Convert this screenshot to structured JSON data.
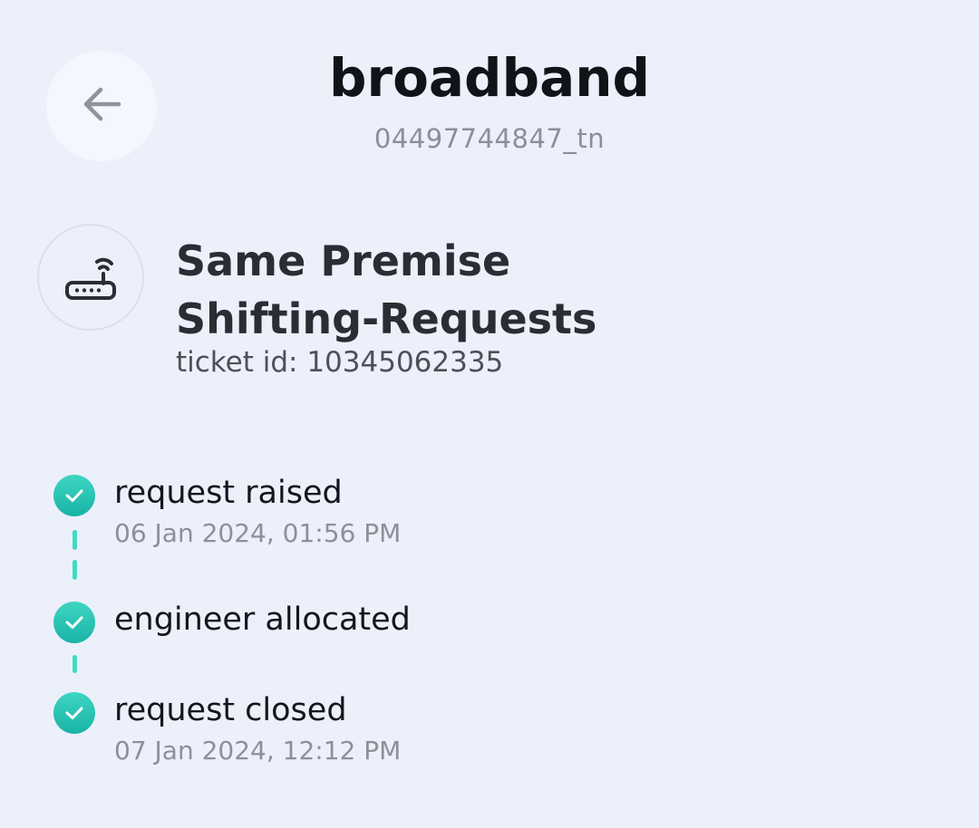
{
  "header": {
    "title": "broadband",
    "subtitle": "04497744847_tn",
    "back_icon": "arrow-left-icon"
  },
  "request": {
    "icon": "router-icon",
    "title_line1": "Same Premise",
    "title_line2": "Shifting-Requests",
    "ticket": "ticket id: 10345062335"
  },
  "timeline": [
    {
      "label": "request raised",
      "time": "06 Jan 2024, 01:56 PM",
      "status": "done"
    },
    {
      "label": "engineer allocated",
      "time": "",
      "status": "done"
    },
    {
      "label": "request closed",
      "time": "07 Jan 2024, 12:12 PM",
      "status": "done"
    }
  ],
  "colors": {
    "background": "#ECF0FB",
    "accent": "#1EC2B1",
    "title": "#111318",
    "muted": "#8B8F98"
  }
}
